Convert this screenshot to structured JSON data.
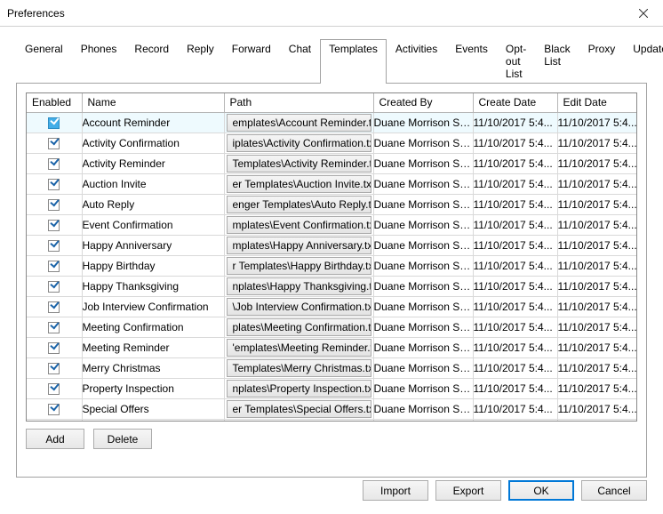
{
  "window": {
    "title": "Preferences"
  },
  "tabs": [
    {
      "label": "General"
    },
    {
      "label": "Phones"
    },
    {
      "label": "Record"
    },
    {
      "label": "Reply"
    },
    {
      "label": "Forward"
    },
    {
      "label": "Chat"
    },
    {
      "label": "Templates",
      "active": true
    },
    {
      "label": "Activities"
    },
    {
      "label": "Events"
    },
    {
      "label": "Opt-out List"
    },
    {
      "label": "Black List"
    },
    {
      "label": "Proxy"
    },
    {
      "label": "Updates"
    }
  ],
  "grid": {
    "columns": {
      "enabled": "Enabled",
      "name": "Name",
      "path": "Path",
      "created_by": "Created By",
      "create_date": "Create Date",
      "edit_date": "Edit Date"
    },
    "rows": [
      {
        "enabled": true,
        "selected": true,
        "name": "Account Reminder",
        "path": "emplates\\Account Reminder.txt",
        "created_by": "Duane Morrison Smith",
        "create_date": "11/10/2017 5:4...",
        "edit_date": "11/10/2017 5:4..."
      },
      {
        "enabled": true,
        "selected": false,
        "name": "Activity Confirmation",
        "path": "iplates\\Activity Confirmation.txt",
        "created_by": "Duane Morrison Smith",
        "create_date": "11/10/2017 5:4...",
        "edit_date": "11/10/2017 5:4..."
      },
      {
        "enabled": true,
        "selected": false,
        "name": "Activity Reminder",
        "path": "Templates\\Activity Reminder.txt",
        "created_by": "Duane Morrison Smith",
        "create_date": "11/10/2017 5:4...",
        "edit_date": "11/10/2017 5:4..."
      },
      {
        "enabled": true,
        "selected": false,
        "name": "Auction Invite",
        "path": "er Templates\\Auction Invite.txt",
        "created_by": "Duane Morrison Smith",
        "create_date": "11/10/2017 5:4...",
        "edit_date": "11/10/2017 5:4..."
      },
      {
        "enabled": true,
        "selected": false,
        "name": "Auto Reply",
        "path": "enger Templates\\Auto Reply.txt",
        "created_by": "Duane Morrison Smith",
        "create_date": "11/10/2017 5:4...",
        "edit_date": "11/10/2017 5:4..."
      },
      {
        "enabled": true,
        "selected": false,
        "name": "Event Confirmation",
        "path": "mplates\\Event Confirmation.txt",
        "created_by": "Duane Morrison Smith",
        "create_date": "11/10/2017 5:4...",
        "edit_date": "11/10/2017 5:4..."
      },
      {
        "enabled": true,
        "selected": false,
        "name": "Happy Anniversary",
        "path": "mplates\\Happy Anniversary.txt",
        "created_by": "Duane Morrison Smith",
        "create_date": "11/10/2017 5:4...",
        "edit_date": "11/10/2017 5:4..."
      },
      {
        "enabled": true,
        "selected": false,
        "name": "Happy Birthday",
        "path": "r Templates\\Happy Birthday.txt",
        "created_by": "Duane Morrison Smith",
        "create_date": "11/10/2017 5:4...",
        "edit_date": "11/10/2017 5:4..."
      },
      {
        "enabled": true,
        "selected": false,
        "name": "Happy Thanksgiving",
        "path": "nplates\\Happy Thanksgiving.txt",
        "created_by": "Duane Morrison Smith",
        "create_date": "11/10/2017 5:4...",
        "edit_date": "11/10/2017 5:4..."
      },
      {
        "enabled": true,
        "selected": false,
        "name": "Job Interview Confirmation",
        "path": "\\Job Interview Confirmation.txt",
        "created_by": "Duane Morrison Smith",
        "create_date": "11/10/2017 5:4...",
        "edit_date": "11/10/2017 5:4..."
      },
      {
        "enabled": true,
        "selected": false,
        "name": "Meeting Confirmation",
        "path": "plates\\Meeting Confirmation.txt",
        "created_by": "Duane Morrison Smith",
        "create_date": "11/10/2017 5:4...",
        "edit_date": "11/10/2017 5:4..."
      },
      {
        "enabled": true,
        "selected": false,
        "name": "Meeting Reminder",
        "path": "'emplates\\Meeting Reminder.txt",
        "created_by": "Duane Morrison Smith",
        "create_date": "11/10/2017 5:4...",
        "edit_date": "11/10/2017 5:4..."
      },
      {
        "enabled": true,
        "selected": false,
        "name": "Merry Christmas",
        "path": "Templates\\Merry Christmas.txt",
        "created_by": "Duane Morrison Smith",
        "create_date": "11/10/2017 5:4...",
        "edit_date": "11/10/2017 5:4..."
      },
      {
        "enabled": true,
        "selected": false,
        "name": "Property Inspection",
        "path": "nplates\\Property Inspection.txt",
        "created_by": "Duane Morrison Smith",
        "create_date": "11/10/2017 5:4...",
        "edit_date": "11/10/2017 5:4..."
      },
      {
        "enabled": true,
        "selected": false,
        "name": "Special Offers",
        "path": "er Templates\\Special Offers.txt",
        "created_by": "Duane Morrison Smith",
        "create_date": "11/10/2017 5:4...",
        "edit_date": "11/10/2017 5:4..."
      },
      {
        "enabled": false,
        "selected": false,
        "name": "",
        "path": "",
        "created_by": "",
        "create_date": "",
        "edit_date": ""
      }
    ]
  },
  "buttons": {
    "add": "Add",
    "delete": "Delete",
    "import": "Import",
    "export": "Export",
    "ok": "OK",
    "cancel": "Cancel"
  }
}
